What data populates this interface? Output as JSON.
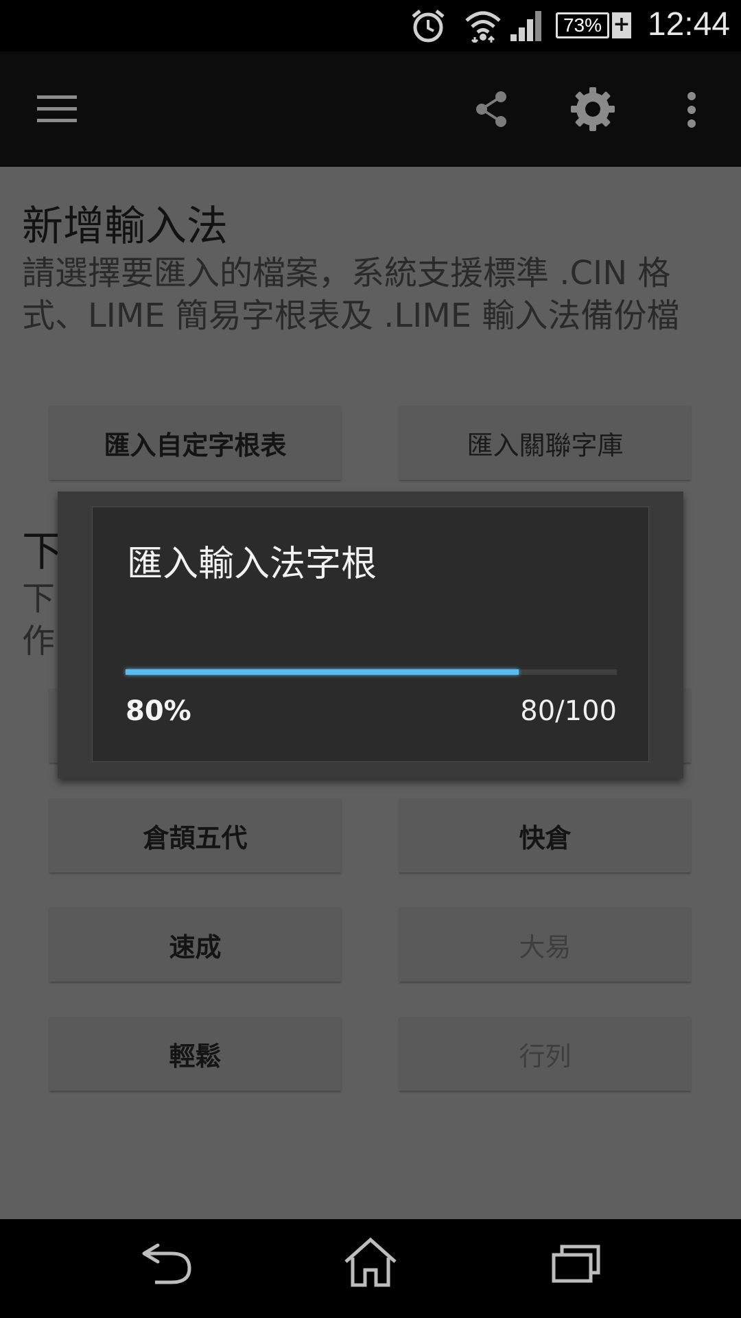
{
  "status_bar": {
    "time": "12:44",
    "battery": "73%",
    "battery_charging": "+",
    "icons": [
      "alarm-icon",
      "wifi-icon",
      "signal-icon",
      "battery-icon"
    ]
  },
  "action_bar": {
    "icons": [
      "menu-icon",
      "share-icon",
      "settings-icon",
      "more-vert-icon"
    ]
  },
  "section_add": {
    "title": "新增輸入法",
    "description": "請選擇要匯入的檔案，系統支援標準 .CIN 格式、LIME 簡易字根表及 .LIME 輸入法備份檔",
    "buttons": [
      "匯入自定字根表",
      "匯入關聯字庫"
    ]
  },
  "section_download": {
    "title_visible": "下",
    "desc_line1_visible": "下",
    "desc_line2_visible": "作"
  },
  "im_buttons": [
    {
      "label": "倉頡五代",
      "enabled": true
    },
    {
      "label": "快倉",
      "enabled": true
    },
    {
      "label": "速成",
      "enabled": true
    },
    {
      "label": "大易",
      "enabled": false
    },
    {
      "label": "輕鬆",
      "enabled": true
    },
    {
      "label": "行列",
      "enabled": false
    }
  ],
  "dialog": {
    "title": "匯入輸入法字根",
    "progress_percent_label": "80%",
    "progress_count_label": "80/100",
    "progress_value": 80,
    "progress_max": 100
  },
  "nav_bar": {
    "icons": [
      "back-icon",
      "home-icon",
      "recents-icon"
    ]
  },
  "colors": {
    "progress": "#5bbcf0",
    "background": "#5f5f5f",
    "dialog": "#2b2b2b"
  }
}
